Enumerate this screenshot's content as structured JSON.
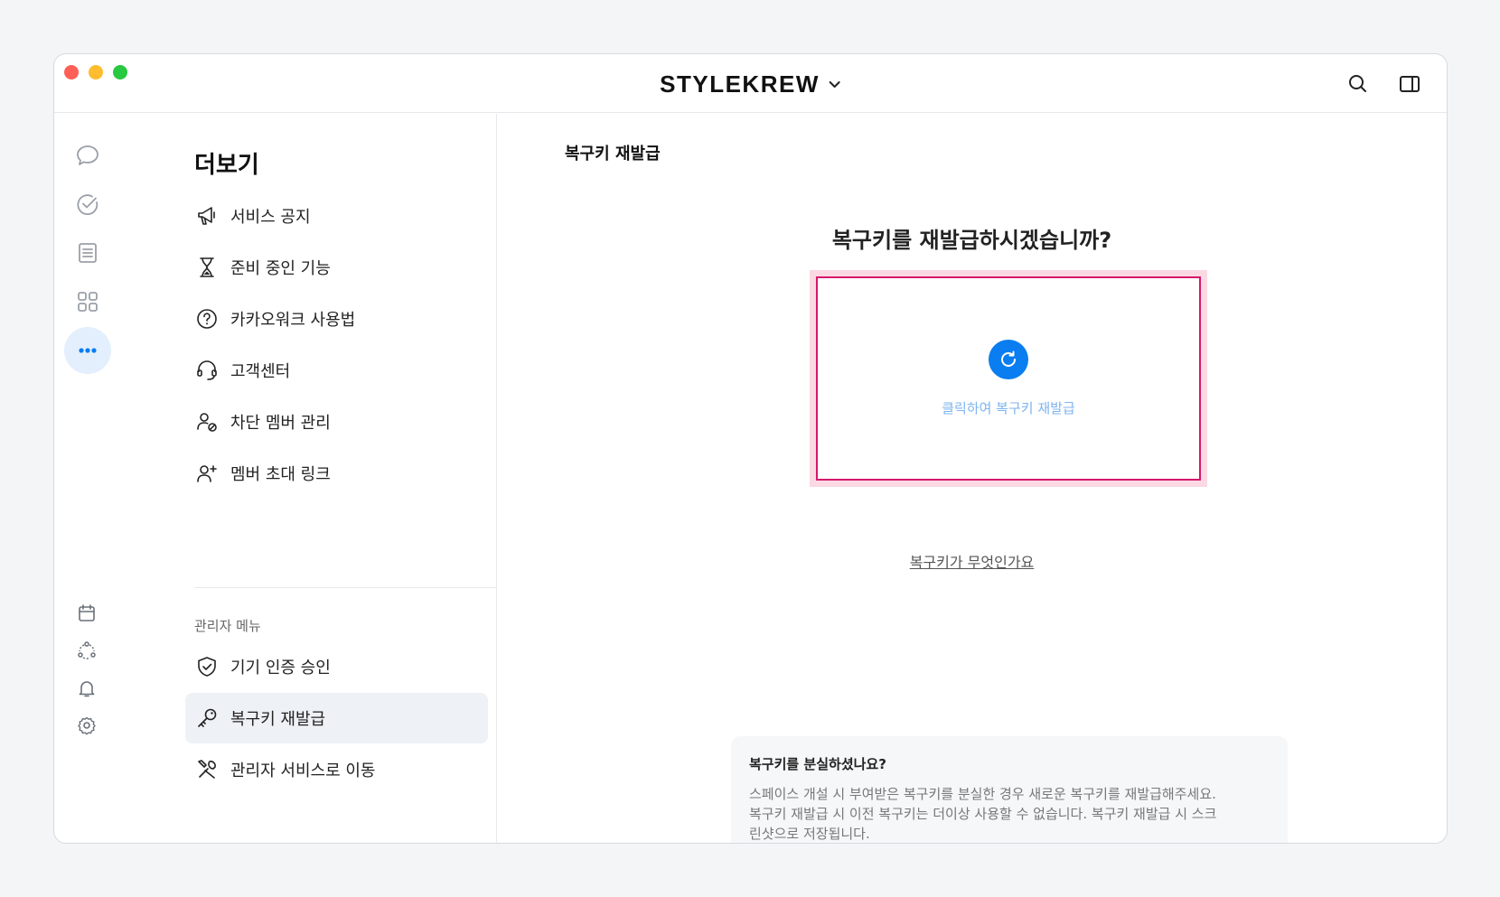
{
  "titlebar": {
    "workspace_name": "STYLEKREW"
  },
  "menu": {
    "title": "더보기",
    "items": [
      {
        "label": "서비스 공지",
        "icon": "megaphone-icon"
      },
      {
        "label": "준비 중인 기능",
        "icon": "hourglass-icon"
      },
      {
        "label": "카카오워크 사용법",
        "icon": "question-icon"
      },
      {
        "label": "고객센터",
        "icon": "headset-icon"
      },
      {
        "label": "차단 멤버 관리",
        "icon": "blocked-user-icon"
      },
      {
        "label": "멤버 초대 링크",
        "icon": "add-user-icon"
      }
    ],
    "admin_section_label": "관리자 메뉴",
    "admin_items": [
      {
        "label": "기기 인증 승인",
        "icon": "shield-check-icon"
      },
      {
        "label": "복구키 재발급",
        "icon": "key-icon",
        "active": true
      },
      {
        "label": "관리자 서비스로 이동",
        "icon": "tools-icon"
      }
    ]
  },
  "main": {
    "page_title": "복구키 재발급",
    "question": "복구키를 재발급하시겠습니까?",
    "reissue_label": "클릭하여 복구키 재발급",
    "what_link": "복구키가 무엇인가요",
    "info": {
      "title": "복구키를 분실하셨나요?",
      "line1": "스페이스 개설 시 부여받은 복구키를 분실한 경우 새로운 복구키를 재발급해주세요.",
      "line2": "복구키 재발급 시 이전 복구키는 더이상 사용할 수 없습니다. 복구키 재발급 시 스크",
      "line3": "린샷으로 저장됩니다."
    }
  },
  "colors": {
    "accent": "#0a7df0",
    "highlight_border": "#d4186b",
    "highlight_bg": "#fbd9e3",
    "active_rail": "#e3effc"
  }
}
